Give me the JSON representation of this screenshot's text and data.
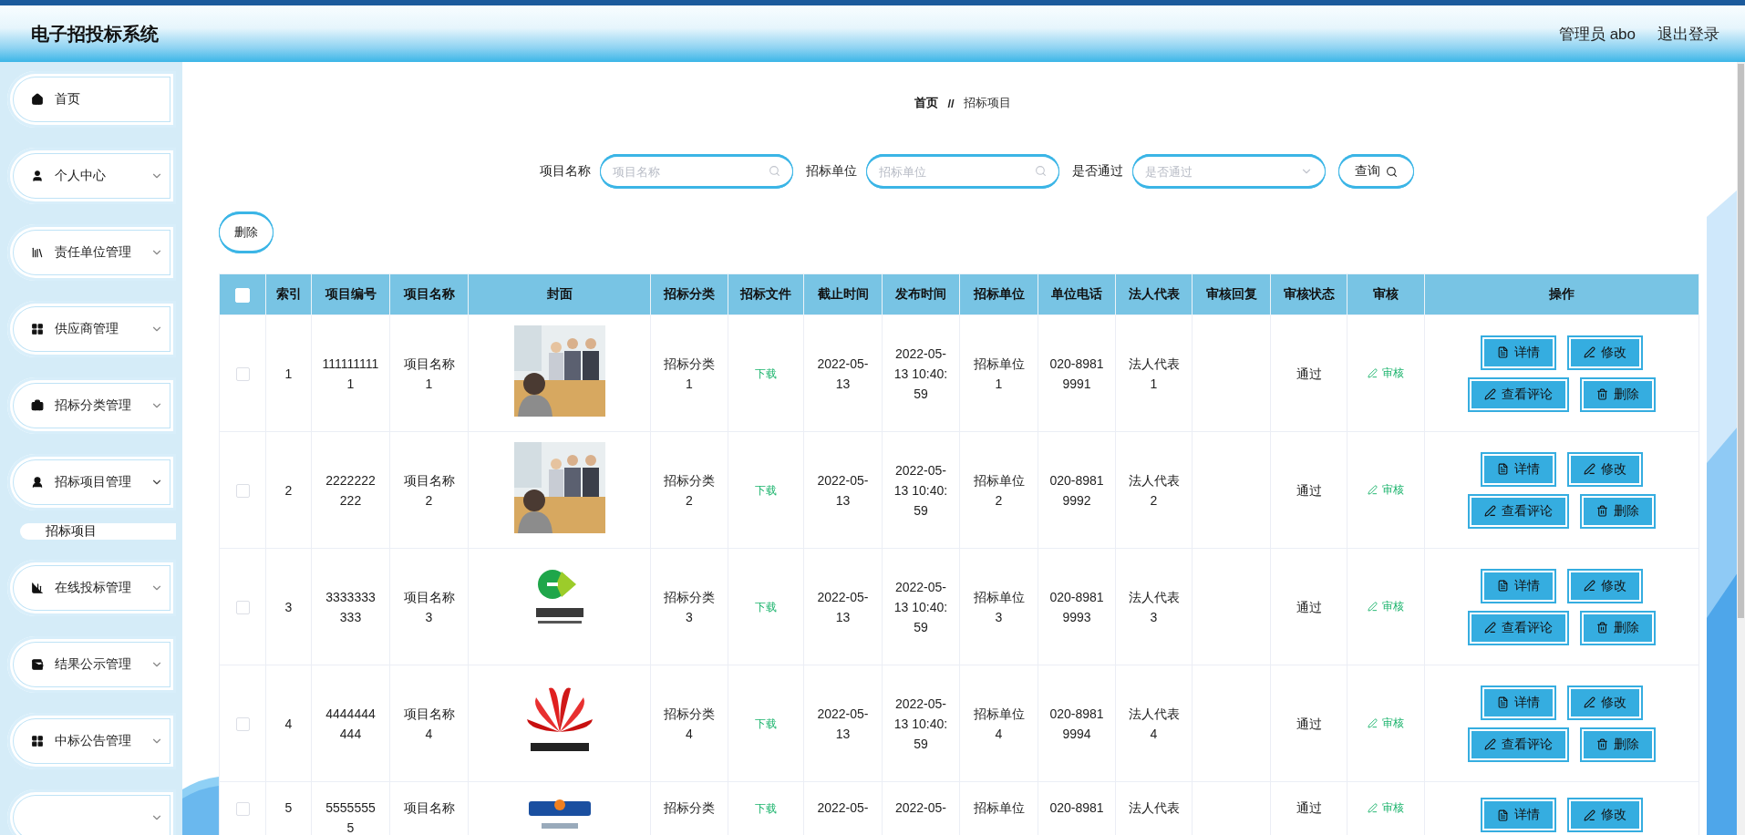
{
  "header": {
    "title": "电子招投标系统",
    "user": "管理员 abo",
    "logout": "退出登录"
  },
  "sidebar": {
    "items": [
      {
        "kind": "link",
        "label": "首页"
      },
      {
        "kind": "group",
        "label": "个人中心"
      },
      {
        "kind": "group",
        "label": "责任单位管理"
      },
      {
        "kind": "group",
        "label": "供应商管理"
      },
      {
        "kind": "group",
        "label": "招标分类管理"
      },
      {
        "kind": "group",
        "label": "招标项目管理",
        "expanded": true,
        "children": [
          {
            "label": "招标项目",
            "selected": true
          }
        ]
      },
      {
        "kind": "group",
        "label": "在线投标管理"
      },
      {
        "kind": "group",
        "label": "结果公示管理"
      },
      {
        "kind": "group",
        "label": "中标公告管理"
      },
      {
        "kind": "group"
      }
    ]
  },
  "breadcrumb": {
    "home": "首页",
    "separator": "//",
    "current": "招标项目"
  },
  "search": {
    "fields": [
      {
        "kind": "text",
        "label": "项目名称",
        "placeholder": "项目名称"
      },
      {
        "kind": "text",
        "label": "招标单位",
        "placeholder": "招标单位"
      },
      {
        "kind": "select",
        "label": "是否通过",
        "placeholder": "是否通过"
      }
    ],
    "button": "查询"
  },
  "toolbar": {
    "delete": "删除"
  },
  "table": {
    "select_all": {
      "checked": false
    },
    "columns": [
      "索引",
      "项目编号",
      "项目名称",
      "封面",
      "招标分类",
      "招标文件",
      "截止时间",
      "发布时间",
      "招标单位",
      "单位电话",
      "法人代表",
      "审核回复",
      "审核状态",
      "审核",
      "操作"
    ],
    "rows": [
      {
        "checked": false,
        "index": "1",
        "code": "1111111111",
        "name": "项目名称1",
        "cover": {
          "kind": "picture"
        },
        "category": "招标分类1",
        "file": "下载",
        "deadline": "2022-05-13",
        "published": "2022-05-13 10:40:59",
        "unit": "招标单位1",
        "phone": "020-89819991",
        "legal_rep": "法人代表1",
        "status": "通过",
        "audit": "审核",
        "actions": [
          "详情",
          "修改",
          "查看评论",
          "删除"
        ]
      },
      {
        "checked": false,
        "index": "2",
        "code": "2222222222",
        "name": "项目名称2",
        "cover": {
          "kind": "picture"
        },
        "category": "招标分类2",
        "file": "下载",
        "deadline": "2022-05-13",
        "published": "2022-05-13 10:40:59",
        "unit": "招标单位2",
        "phone": "020-89819992",
        "legal_rep": "法人代表2",
        "status": "通过",
        "audit": "审核",
        "actions": [
          "详情",
          "修改",
          "查看评论",
          "删除"
        ]
      },
      {
        "checked": false,
        "index": "3",
        "code": "3333333333",
        "name": "项目名称3",
        "cover": {
          "kind": "picture"
        },
        "category": "招标分类3",
        "file": "下载",
        "deadline": "2022-05-13",
        "published": "2022-05-13 10:40:59",
        "unit": "招标单位3",
        "phone": "020-89819993",
        "legal_rep": "法人代表3",
        "status": "通过",
        "audit": "审核",
        "actions": [
          "详情",
          "修改",
          "查看评论",
          "删除"
        ]
      },
      {
        "checked": false,
        "index": "4",
        "code": "4444444444",
        "name": "项目名称4",
        "cover": {
          "kind": "picture"
        },
        "category": "招标分类4",
        "file": "下载",
        "deadline": "2022-05-13",
        "published": "2022-05-13 10:40:59",
        "unit": "招标单位4",
        "phone": "020-89819994",
        "legal_rep": "法人代表4",
        "status": "通过",
        "audit": "审核",
        "actions": [
          "详情",
          "修改",
          "查看评论",
          "删除"
        ]
      },
      {
        "checked": false,
        "index": "5",
        "code": "55555555",
        "name": "项目名称",
        "cover": {
          "kind": "picture"
        },
        "category": "招标分类",
        "file": "下载",
        "deadline": "2022-05-",
        "published": "2022-05-",
        "unit": "招标单位",
        "phone": "020-8981",
        "legal_rep": "法人代表",
        "status": "通过",
        "audit": "审核",
        "actions": [
          "详情",
          "修改"
        ]
      }
    ]
  }
}
